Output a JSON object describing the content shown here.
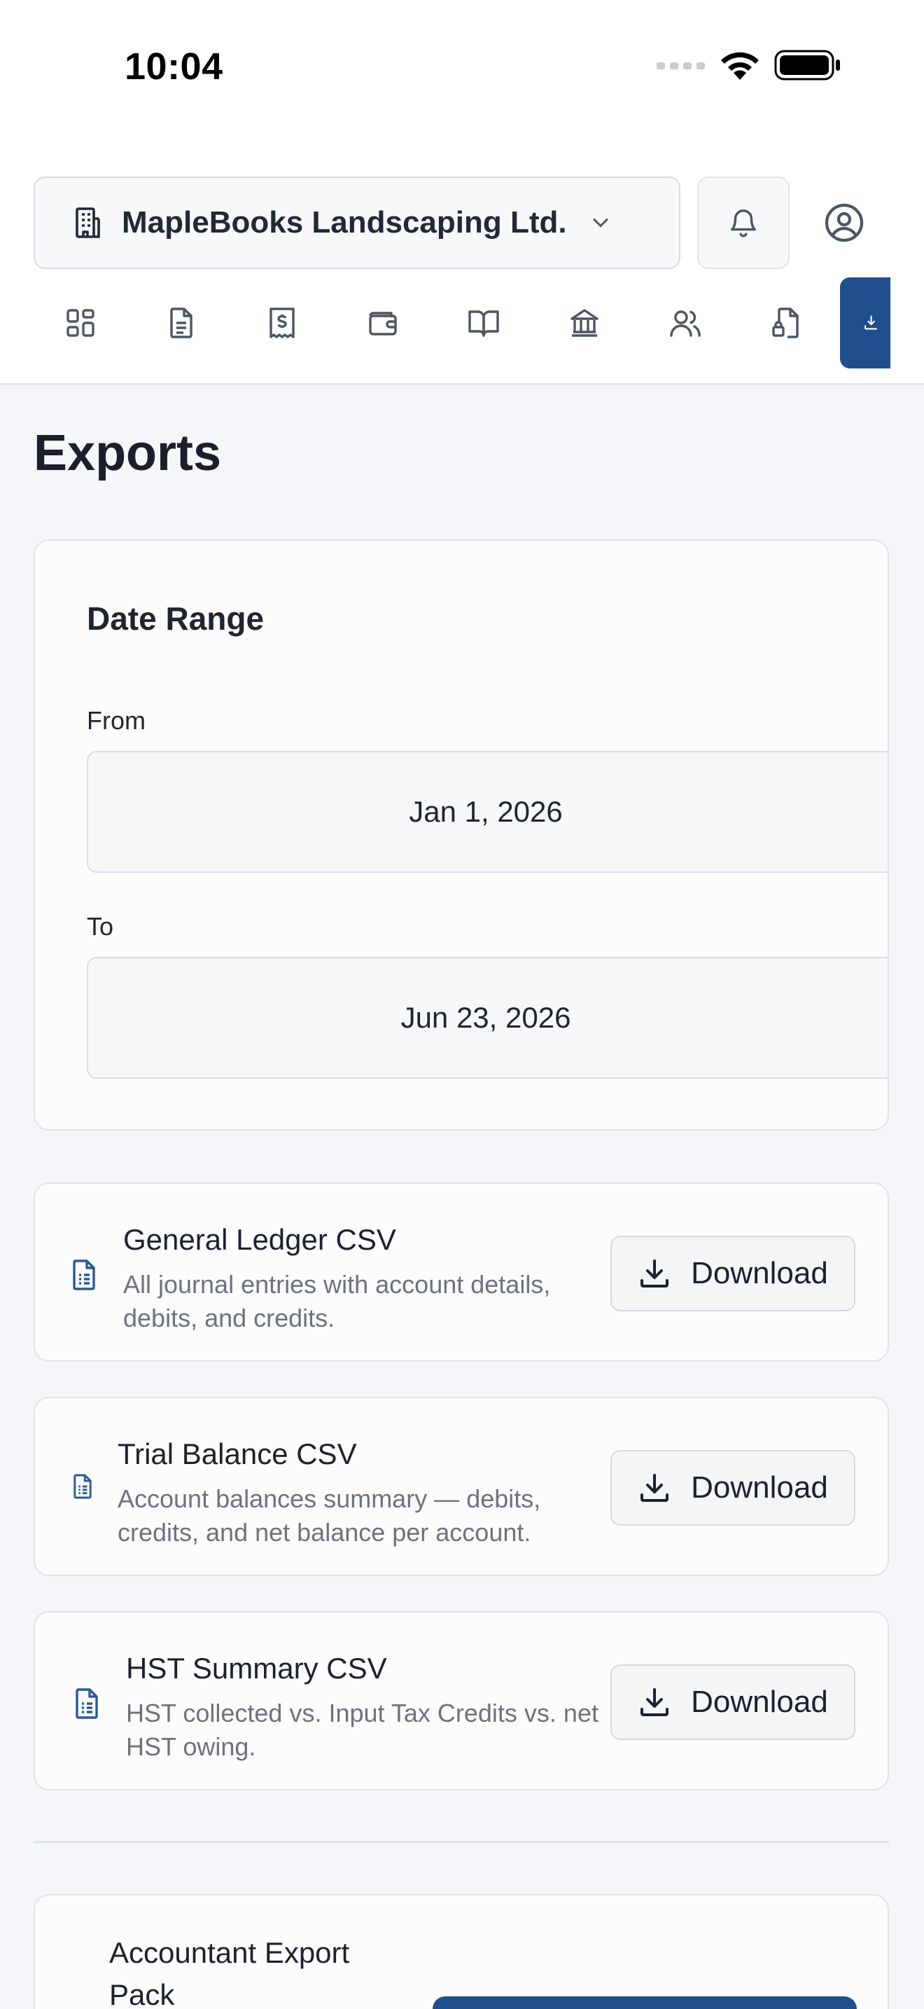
{
  "status_bar": {
    "time": "10:04"
  },
  "header": {
    "organization": "MapleBooks Landscaping Ltd.",
    "nav_icons": [
      "dashboard-icon",
      "invoice-icon",
      "receipt-icon",
      "wallet-icon",
      "ledger-book-icon",
      "bank-icon",
      "contacts-icon",
      "tax-file-icon",
      "export-download-icon"
    ],
    "active_nav": "export-download-icon"
  },
  "page": {
    "title": "Exports"
  },
  "date_range": {
    "title": "Date Range",
    "from_label": "From",
    "from_value": "Jan 1, 2026",
    "to_label": "To",
    "to_value": "Jun 23, 2026"
  },
  "exports": [
    {
      "title": "General Ledger CSV",
      "description": "All journal entries with account details, debits, and credits.",
      "button": "Download"
    },
    {
      "title": "Trial Balance CSV",
      "description": "Account balances summary — debits, credits, and net balance per account.",
      "button": "Download"
    },
    {
      "title": "HST Summary CSV",
      "description": "HST collected vs. Input Tax Credits vs. net HST owing.",
      "button": "Download"
    }
  ],
  "accountant_pack": {
    "title": "Accountant Export Pack"
  },
  "colors": {
    "primary": "#1e4f8c",
    "icon_blue": "#2a5a94",
    "muted_text": "#6b7280",
    "background": "#f4f6f9"
  }
}
